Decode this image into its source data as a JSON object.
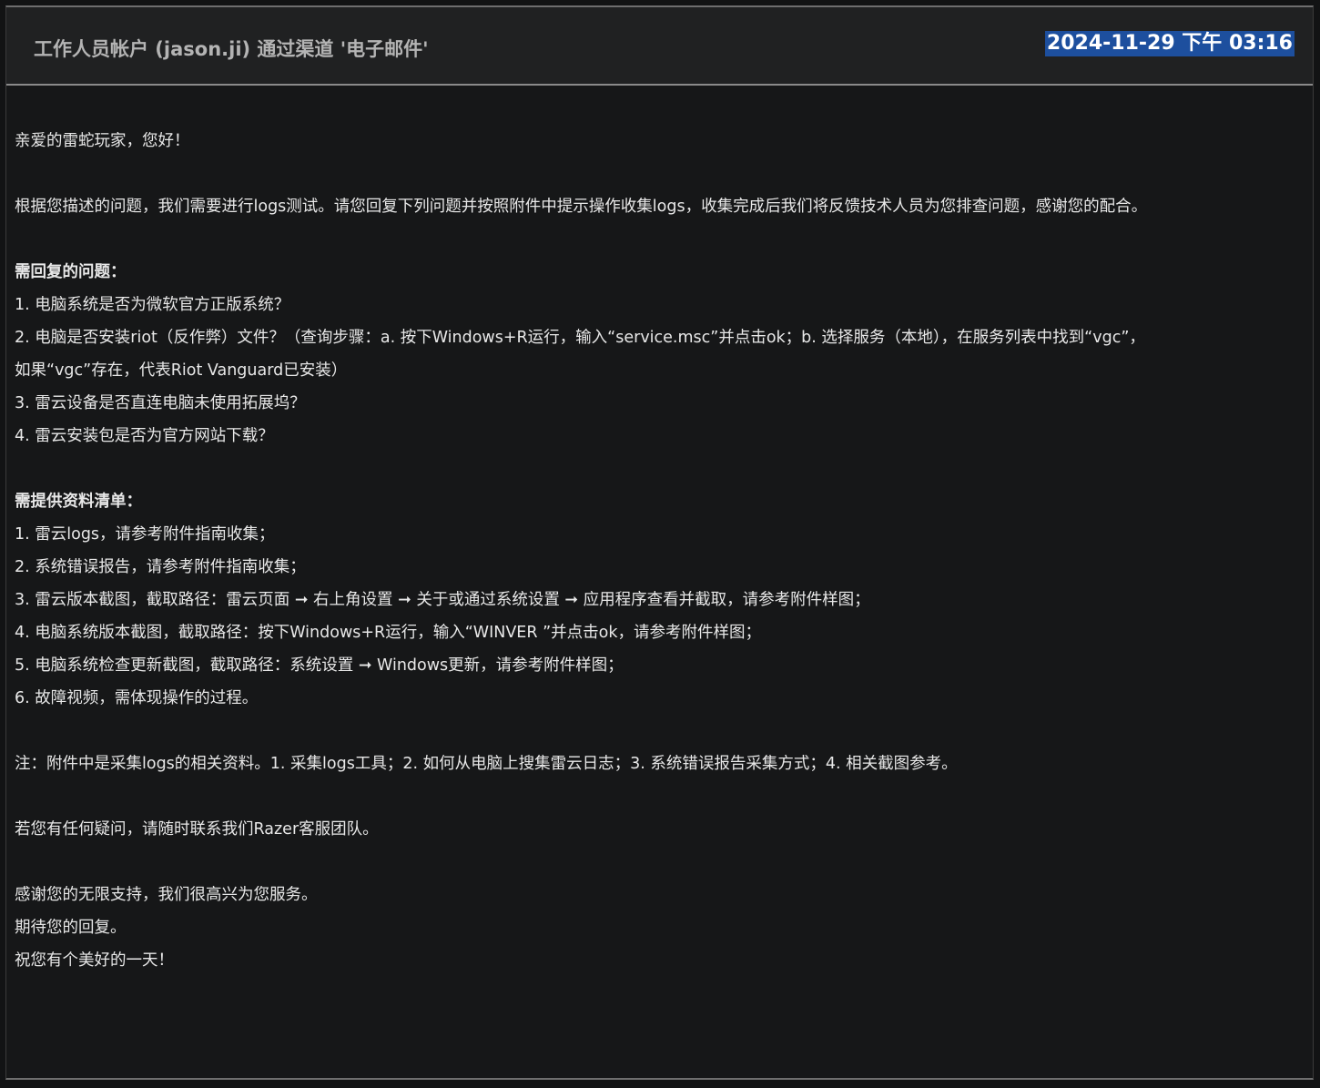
{
  "header": {
    "sender": "工作人员帐户 (jason.ji) 通过渠道 '电子邮件'",
    "timestamp": "2024-11-29 下午 03:16"
  },
  "message": {
    "greeting": "亲爱的雷蛇玩家，您好！",
    "intro": "根据您描述的问题，我们需要进行logs测试。请您回复下列问题并按照附件中提示操作收集logs，收集完成后我们将反馈技术人员为您排查问题，感谢您的配合。",
    "questions_title": "需回复的问题：",
    "questions": [
      "1. 电脑系统是否为微软官方正版系统？",
      "2. 电脑是否安装riot（反作弊）文件？（查询步骤：a. 按下Windows+R运行，输入“service.msc”并点击ok；b. 选择服务（本地），在服务列表中找到“vgc”，",
      "如果“vgc”存在，代表Riot Vanguard已安装）",
      "3. 雷云设备是否直连电脑未使用拓展坞？",
      "4. 雷云安装包是否为官方网站下载？"
    ],
    "materials_title": "需提供资料清单：",
    "materials": [
      "1. 雷云logs，请参考附件指南收集；",
      "2. 系统错误报告，请参考附件指南收集；",
      "3. 雷云版本截图，截取路径：雷云页面 ➞ 右上角设置 ➞ 关于或通过系统设置 ➞ 应用程序查看并截取，请参考附件样图；",
      "4. 电脑系统版本截图，截取路径：按下Windows+R运行，输入“WINVER ”并点击ok，请参考附件样图；",
      "5. 电脑系统检查更新截图，截取路径：系统设置 ➞ Windows更新，请参考附件样图；",
      "6. 故障视频，需体现操作的过程。"
    ],
    "note": "注：附件中是采集logs的相关资料。1. 采集logs工具；2. 如何从电脑上搜集雷云日志；3. 系统错误报告采集方式；4. 相关截图参考。",
    "contact": "若您有任何疑问，请随时联系我们Razer客服团队。",
    "closing": [
      "感谢您的无限支持，我们很高兴为您服务。",
      "期待您的回复。",
      "祝您有个美好的一天！"
    ]
  }
}
